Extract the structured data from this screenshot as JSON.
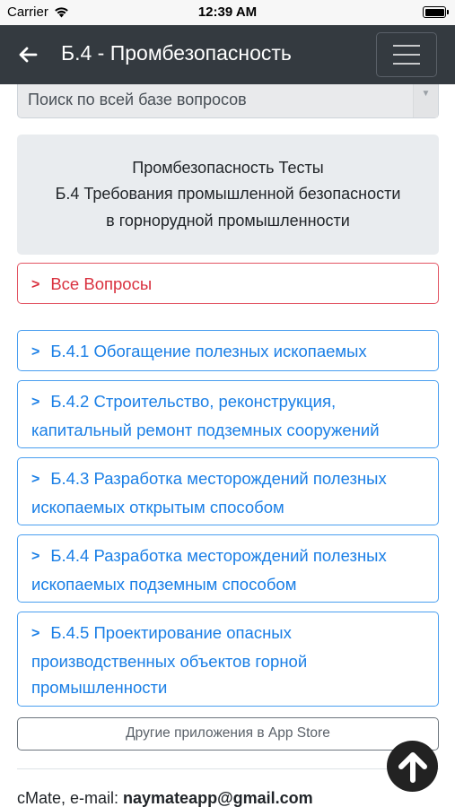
{
  "status": {
    "carrier": "Carrier",
    "time": "12:39 AM"
  },
  "nav": {
    "title": "Б.4 - Промбезопасность"
  },
  "search": {
    "placeholder": "Поиск по всей базе вопросов"
  },
  "info": {
    "line1": "Промбезопасность Тесты",
    "line2": "Б.4 Требования промышленной безопасности",
    "line3": "в горнорудной промышленности"
  },
  "categories": [
    {
      "line1": "Все Вопросы",
      "line2": "",
      "line3": ""
    },
    {
      "line1": "Б.4.1 Обогащение полезных ископаемых",
      "line2": "",
      "line3": ""
    },
    {
      "line1": "Б.4.2 Строительство, реконструкция,",
      "line2": "капитальный ремонт подземных сооружений",
      "line3": ""
    },
    {
      "line1": "Б.4.3 Разработка месторождений полезных",
      "line2": "ископаемых открытым способом",
      "line3": ""
    },
    {
      "line1": "Б.4.4 Разработка месторождений полезных",
      "line2": "ископаемых подземным способом",
      "line3": ""
    },
    {
      "line1": "Б.4.5 Проектирование опасных",
      "line2": "производственных объектов горной",
      "line3": "промышленности"
    }
  ],
  "appstore": {
    "label": "Другие приложения в App Store"
  },
  "footer": {
    "prefix": "cMate, e-mail: ",
    "email": "naymateapp@gmail.com"
  },
  "colors": {
    "navbar": "#343a40",
    "accent_blue": "#1a7fe6",
    "accent_red": "#d9313f"
  },
  "icons": [
    "wifi-icon",
    "battery-icon",
    "back-arrow-icon",
    "menu-icon",
    "chevron-right-icon",
    "arrow-up-icon"
  ]
}
